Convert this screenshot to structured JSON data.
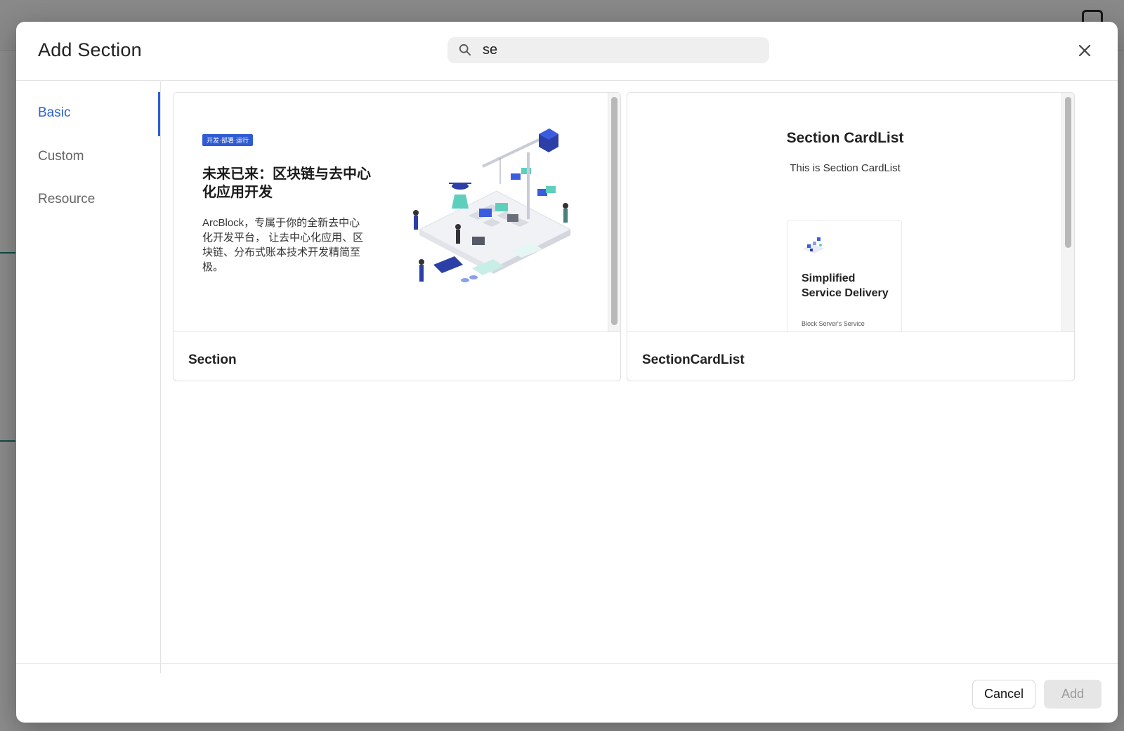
{
  "dialog": {
    "title": "Add Section",
    "search": {
      "value": "se",
      "placeholder": ""
    },
    "close_icon": "close-icon"
  },
  "sidebar": {
    "items": [
      {
        "label": "Basic",
        "active": true
      },
      {
        "label": "Custom",
        "active": false
      },
      {
        "label": "Resource",
        "active": false
      }
    ]
  },
  "cards": [
    {
      "name": "Section",
      "preview": {
        "badge": "开发·部署·运行",
        "headline": "未来已来：区块链与去中心化应用开发",
        "body": "ArcBlock，专属于你的全新去中心化开发平台， 让去中心化应用、区块链、分布式账本技术开发精简至极。"
      }
    },
    {
      "name": "SectionCardList",
      "preview": {
        "title": "Section CardList",
        "subtitle": "This is Section CardList",
        "card_title": "Simplified Service Delivery",
        "card_subtitle": "Block Server's Service"
      }
    }
  ],
  "footer": {
    "cancel_label": "Cancel",
    "add_label": "Add"
  },
  "colors": {
    "accent": "#2c5fd6",
    "badge": "#2f5bd3",
    "iso_teal": "#5fcfbd",
    "iso_blue": "#3a5de0"
  }
}
